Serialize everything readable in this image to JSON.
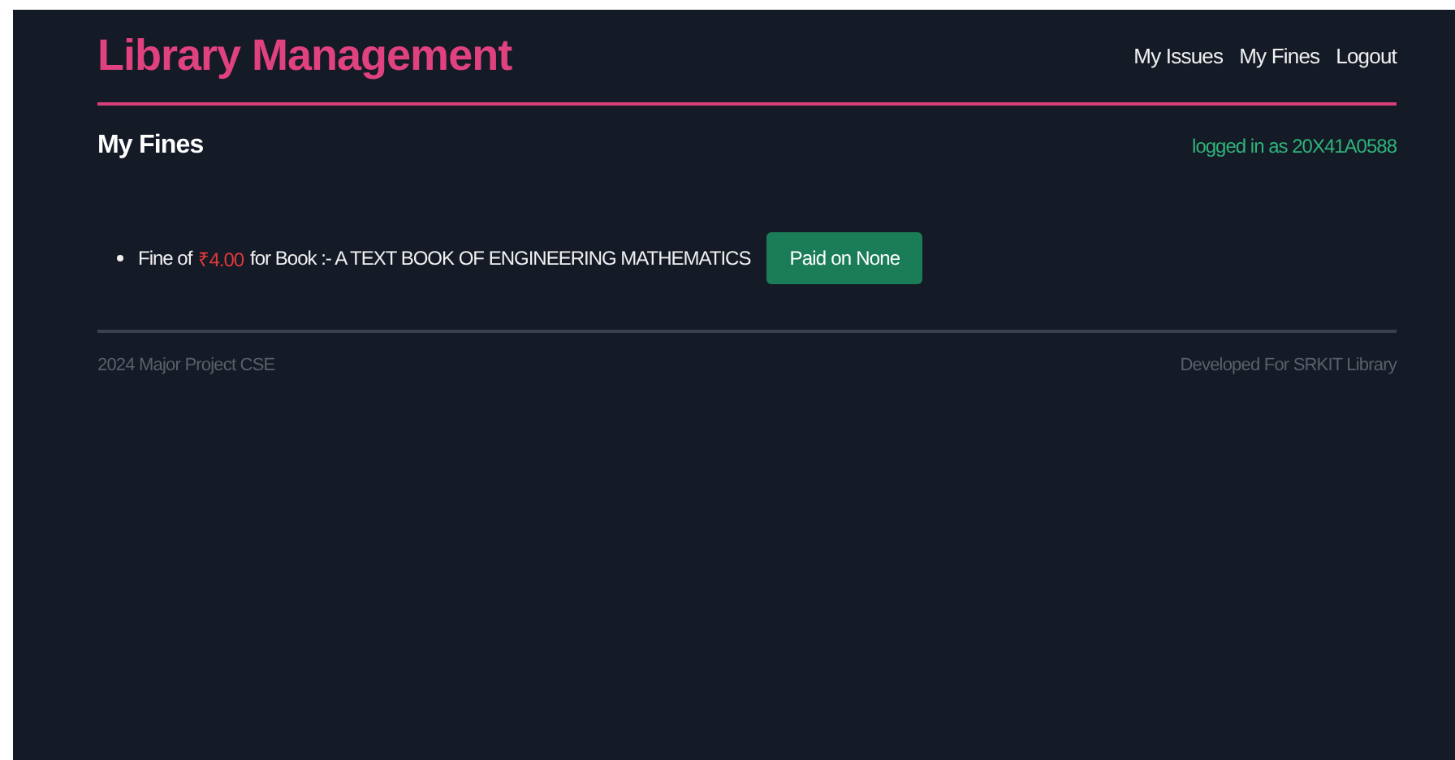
{
  "header": {
    "title": "Library Management",
    "nav": [
      {
        "label": "My Issues"
      },
      {
        "label": "My Fines"
      },
      {
        "label": "Logout"
      }
    ]
  },
  "page": {
    "heading": "My Fines",
    "login_status": "logged in as 20X41A0588"
  },
  "fines": [
    {
      "prefix": "Fine of",
      "amount": "₹4.00",
      "suffix": "for Book :- A TEXT BOOK OF ENGINEERING MATHEMATICS",
      "button": "Paid on None"
    }
  ],
  "footer": {
    "left": "2024 Major Project CSE",
    "right": "Developed For SRKIT Library"
  }
}
